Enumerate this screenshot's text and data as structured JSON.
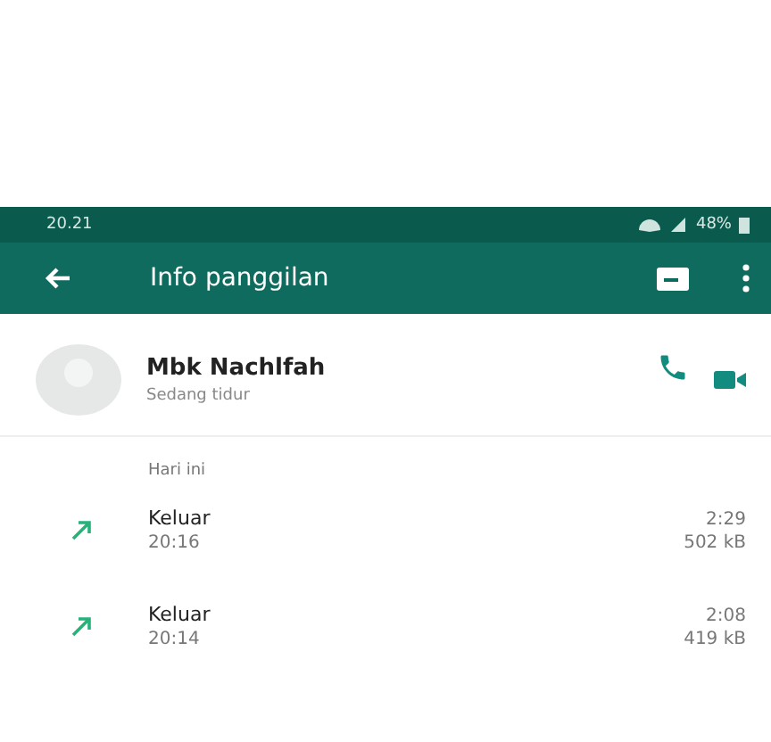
{
  "status_bar": {
    "time": "20.21",
    "battery": "48%"
  },
  "toolbar": {
    "title": "Info panggilan"
  },
  "contact": {
    "name": "Mbk Nachlfah",
    "status": "Sedang tidur"
  },
  "section": "Hari ini",
  "calls": [
    {
      "kind": "outgoing",
      "label": "Keluar",
      "time": "20:16",
      "duration": "2:29",
      "size": "502 kB"
    },
    {
      "kind": "outgoing",
      "label": "Keluar",
      "time": "20:14",
      "duration": "2:08",
      "size": "419 kB"
    }
  ]
}
